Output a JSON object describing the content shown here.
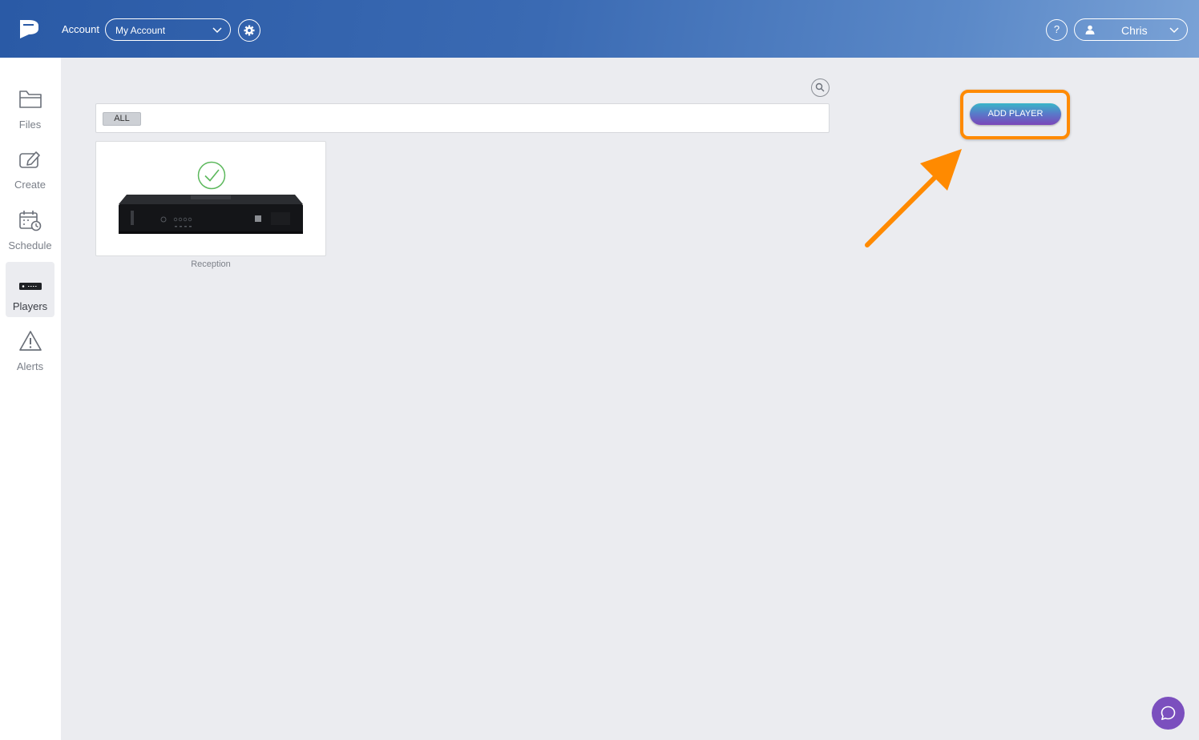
{
  "header": {
    "account_label": "Account",
    "account_select_value": "My Account",
    "help_label": "?",
    "user_name": "Chris"
  },
  "sidebar": {
    "items": [
      {
        "label": "Files",
        "icon": "folder-icon"
      },
      {
        "label": "Create",
        "icon": "edit-icon"
      },
      {
        "label": "Schedule",
        "icon": "calendar-clock-icon"
      },
      {
        "label": "Players",
        "icon": "player-device-icon",
        "active": true
      },
      {
        "label": "Alerts",
        "icon": "warning-icon"
      }
    ]
  },
  "main": {
    "filter_chip": "ALL",
    "players": [
      {
        "name": "Reception",
        "status": "online",
        "status_color": "#5cb85c"
      }
    ],
    "add_player_label": "ADD PLAYER"
  },
  "colors": {
    "header_accent": "#2a5aa6",
    "highlight": "#ff8a00",
    "chat_button": "#7b4fbe"
  }
}
